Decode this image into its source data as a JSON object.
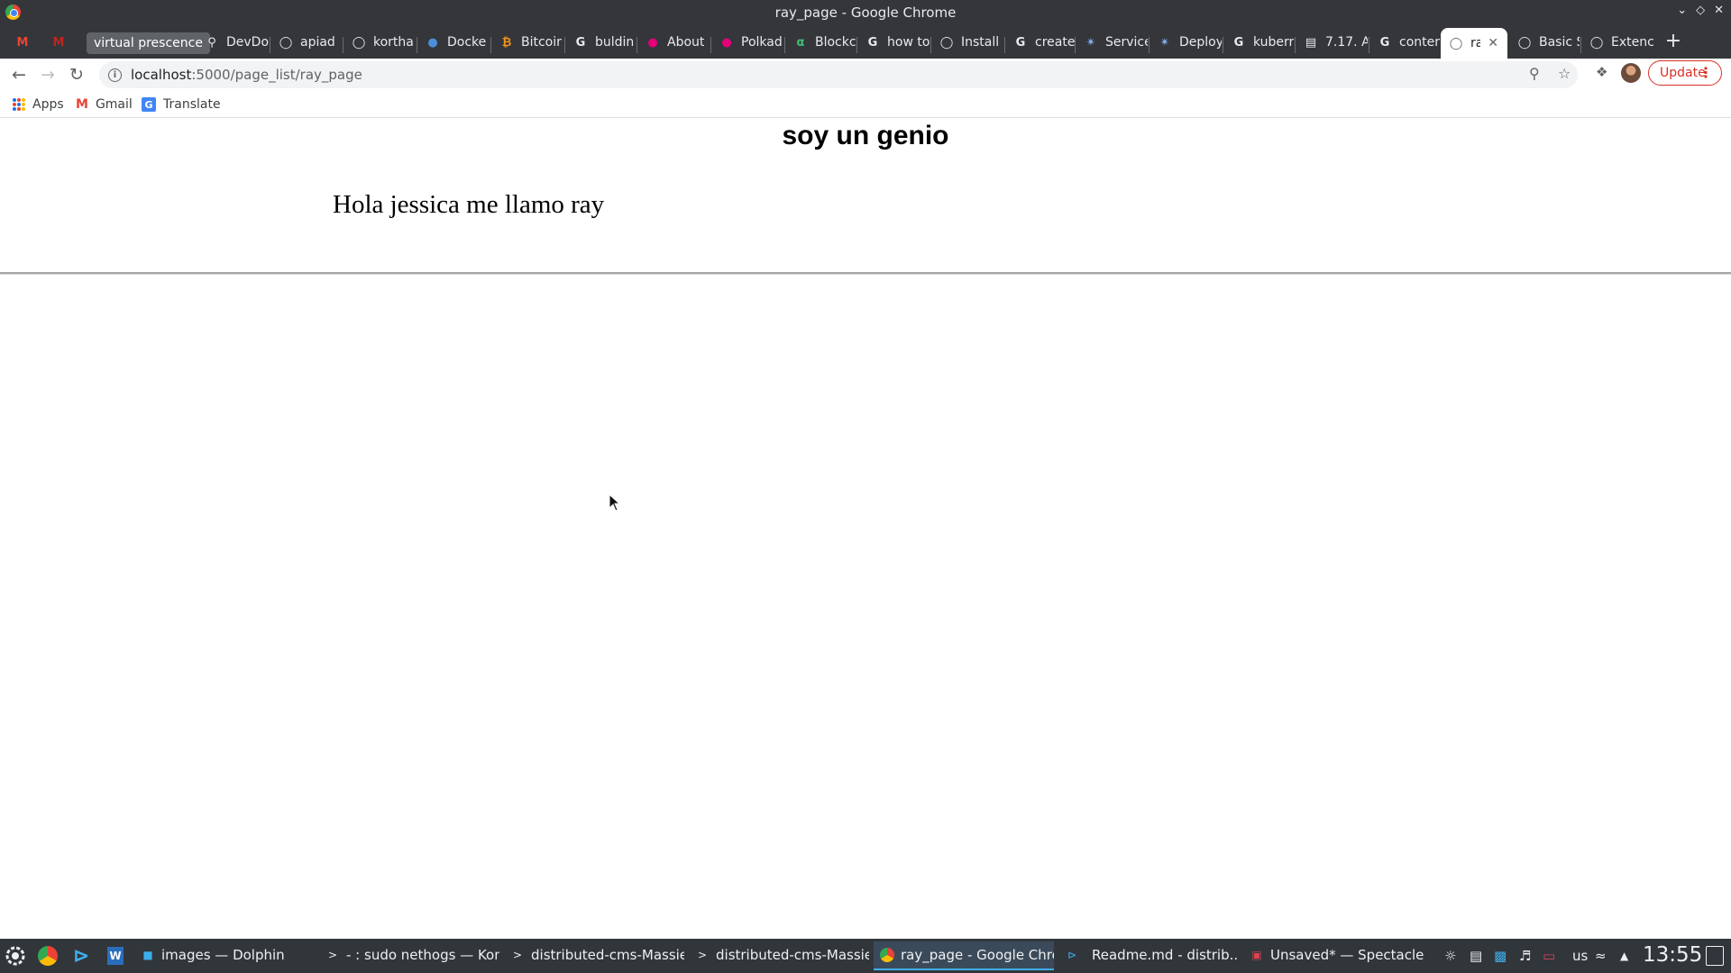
{
  "window": {
    "title": "ray_page - Google Chrome"
  },
  "tabs": [
    {
      "label": "",
      "icon": "gmail-icon"
    },
    {
      "label": "",
      "icon": "gmail-icon"
    },
    {
      "label": "virtual prescence",
      "icon": "tab-group-chip"
    },
    {
      "label": "DevDo",
      "icon": "search-doc-icon"
    },
    {
      "label": "apiad (",
      "icon": "github-icon"
    },
    {
      "label": "kortha",
      "icon": "github-icon"
    },
    {
      "label": "Docke",
      "icon": "globe-icon"
    },
    {
      "label": "Bitcoin",
      "icon": "bitcoin-icon"
    },
    {
      "label": "buldin",
      "icon": "google-icon"
    },
    {
      "label": "About",
      "icon": "polkadot-icon"
    },
    {
      "label": "Polkad",
      "icon": "polkadot-icon"
    },
    {
      "label": "Blockc",
      "icon": "blockchain-icon"
    },
    {
      "label": "how to",
      "icon": "google-icon"
    },
    {
      "label": "Install",
      "icon": "globe-icon"
    },
    {
      "label": "create",
      "icon": "google-icon"
    },
    {
      "label": "Service",
      "icon": "kubernetes-icon"
    },
    {
      "label": "Deploy",
      "icon": "kubernetes-icon"
    },
    {
      "label": "kuberr",
      "icon": "google-icon"
    },
    {
      "label": "7.17. A",
      "icon": "doc-icon"
    },
    {
      "label": "conter",
      "icon": "google-icon"
    },
    {
      "label": "ray",
      "icon": "globe-icon"
    },
    {
      "label": "Basic S",
      "icon": "globe-icon"
    },
    {
      "label": "Extenc",
      "icon": "globe-icon"
    }
  ],
  "toolbar": {
    "url_host": "localhost",
    "url_path": ":5000/page_list/ray_page",
    "update_label": "Update"
  },
  "bookmarks": [
    {
      "label": "Apps"
    },
    {
      "label": "Gmail"
    },
    {
      "label": "Translate"
    }
  ],
  "page": {
    "heading": "soy un genio",
    "paragraph": "Hola jessica me llamo ray"
  },
  "taskbar": {
    "tasks": [
      {
        "label": "images — Dolphin"
      },
      {
        "label": "- : sudo nethogs — Kon..."
      },
      {
        "label": "distributed-cms-Massie..."
      },
      {
        "label": "distributed-cms-Massie..."
      },
      {
        "label": "ray_page - Google Chro..."
      },
      {
        "label": "Readme.md - distrib..."
      },
      {
        "label": "Unsaved* — Spectacle"
      }
    ],
    "keyboard_layout": "us",
    "clock": "13:55"
  },
  "colors": {
    "chrome_dark": "#35363a",
    "update_red": "#d93025",
    "taskbar": "#31363b",
    "taskbar_active_accent": "#3daee9"
  }
}
